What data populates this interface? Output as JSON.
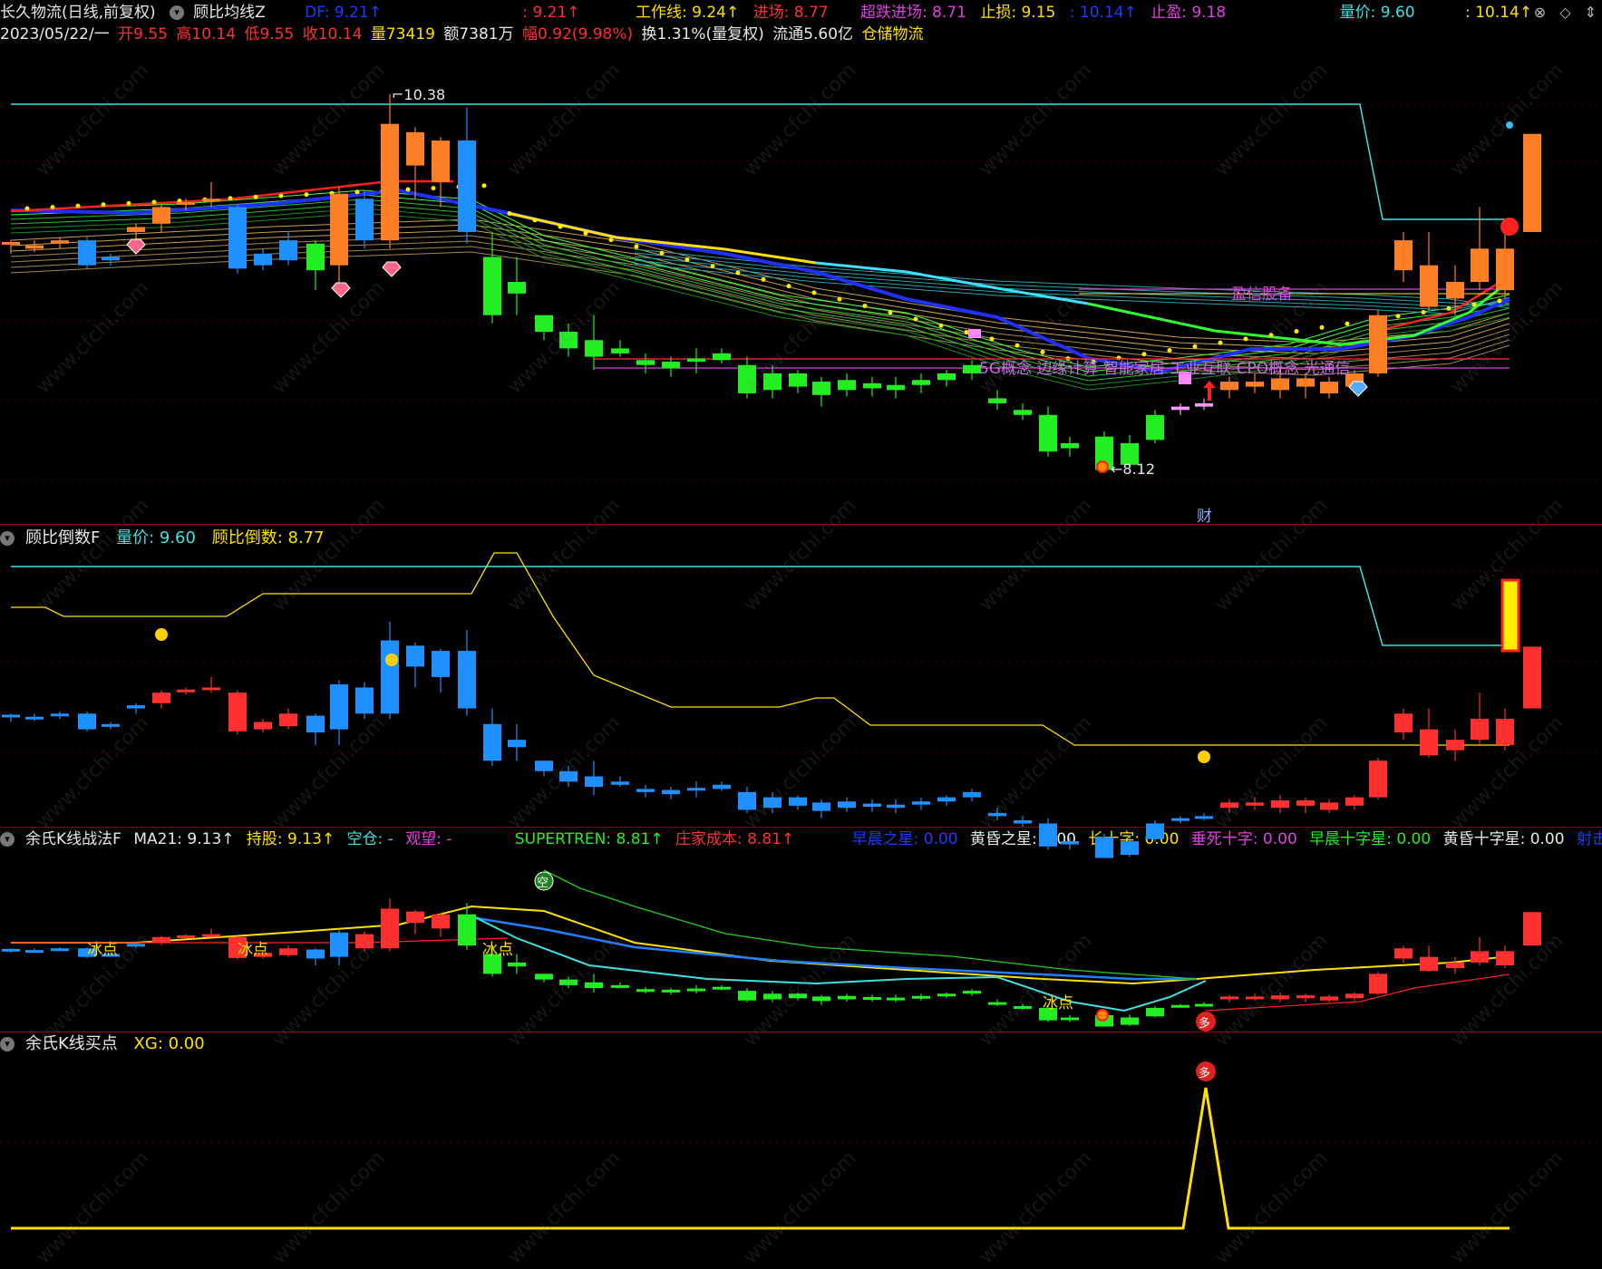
{
  "header": {
    "stock_name": "长久物流(日线,前复权)",
    "indicator_name": "顾比均线Z",
    "df": "DF: 9.21↑",
    "df2": ": 9.21↑",
    "work_line": "工作线: 9.24↑",
    "entry": "进场: 8.77",
    "oversold_entry": "超跌进场: 8.71",
    "stop_loss": "止损: 9.15",
    "stop_loss2": ": 10.14↑",
    "take_profit": "止盈: 9.18",
    "volume_price": "量价: 9.60",
    "vp2": ": 10.14↑"
  },
  "info": {
    "date": "2023/05/22/一",
    "open": "开9.55",
    "high": "高10.14",
    "low": "低9.55",
    "close": "收10.14",
    "volume": "量73419",
    "amount": "额7381万",
    "change": "幅0.92(9.98%)",
    "turnover": "换1.31%(量复权)",
    "float_cap": "流通5.60亿",
    "sector": "仓储物流"
  },
  "main_chart": {
    "high_label": "10.38",
    "low_label": "8.12",
    "concept_top": "盈信股备",
    "concept_line": "5G概念 边缘计算 智能家居 工业互联 CPO概念 光通信",
    "cai_label": "财"
  },
  "pane2": {
    "name": "顾比倒数F",
    "volume_price": "量价: 9.60",
    "countdown": "顾比倒数: 8.77"
  },
  "pane3": {
    "name": "余氏K线战法F",
    "ma21": "MA21: 9.13↑",
    "hold": "持股: 9.13↑",
    "empty": "空仓: -",
    "watch": "观望: -",
    "supertrend": "SUPERTREN: 8.81↑",
    "cost": "庄家成本: 8.81↑",
    "morning_star": "早晨之星: 0.00",
    "evening_star": "黄昏之星: 0.00",
    "long_cross": "长十字: 0.00",
    "hanging_cross": "垂死十字: 0.00",
    "morning_cross": "早晨十字星: 0.00",
    "evening_cross": "黄昏十字星: 0.00",
    "shooting_star": "射击之星: ",
    "ice_label": "冰点",
    "kong_label": "空",
    "duo_label": "多"
  },
  "pane4": {
    "name": "余氏K线买点",
    "xg": "XG: 0.00",
    "duo_label": "多"
  },
  "watermark": "www.cfchi.com",
  "colors": {
    "up": "#ff3030",
    "down_blue": "#1e90ff",
    "down_green": "#22ee22",
    "orange": "#ff7f27",
    "yellow": "#ffee00",
    "cyan": "#40e0e0",
    "magenta": "#e040e0"
  }
}
